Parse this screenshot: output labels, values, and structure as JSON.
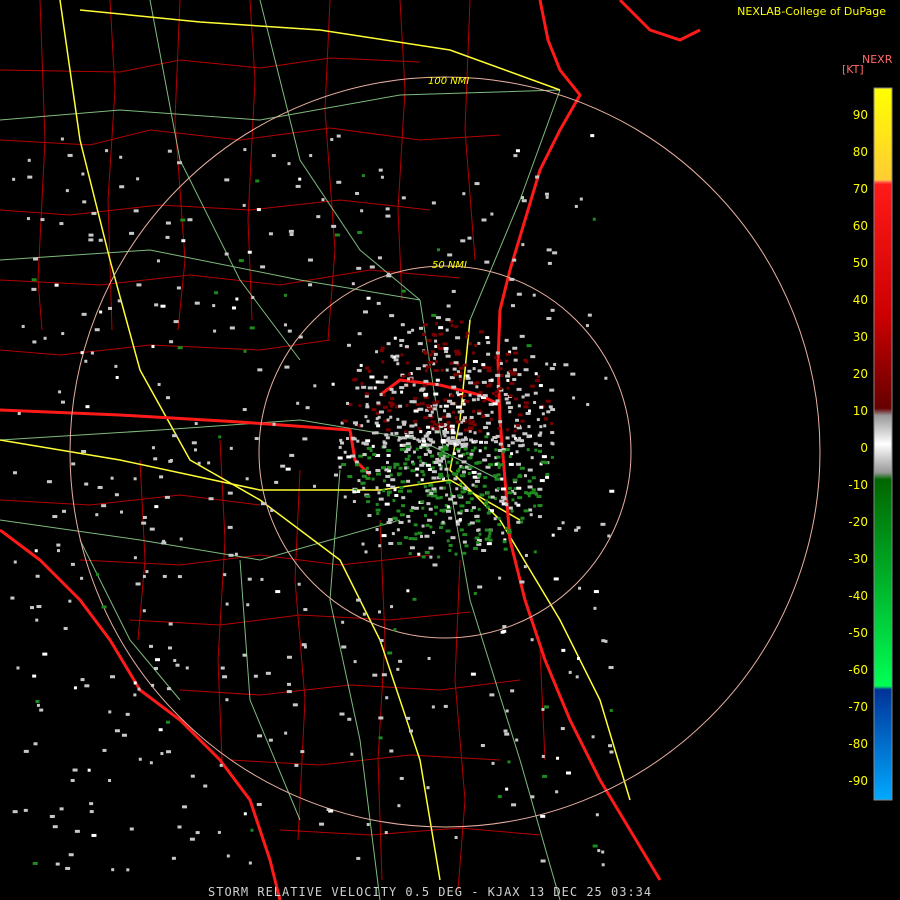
{
  "credit": "NEXLAB-College of DuPage",
  "footer": "STORM RELATIVE VELOCITY 0.5 DEG - KJAX 13 DEC 25 03:34",
  "legend": {
    "title": "NEXR",
    "unit": "[KT]",
    "ticks": [
      "90",
      "80",
      "70",
      "60",
      "50",
      "40",
      "30",
      "20",
      "10",
      "0",
      "-10",
      "-20",
      "-30",
      "-40",
      "-50",
      "-60",
      "-70",
      "-80",
      "-90"
    ]
  },
  "range_rings": [
    "100 NMI",
    "50 NMI"
  ],
  "colors": {
    "background": "#000000",
    "county_lines": "#b40000",
    "state_lines": "#ff1a1a",
    "highways": "#ffff33",
    "roads": "#9ee89e",
    "range_ring": "#e8b0a0",
    "label": "#ffff00"
  }
}
